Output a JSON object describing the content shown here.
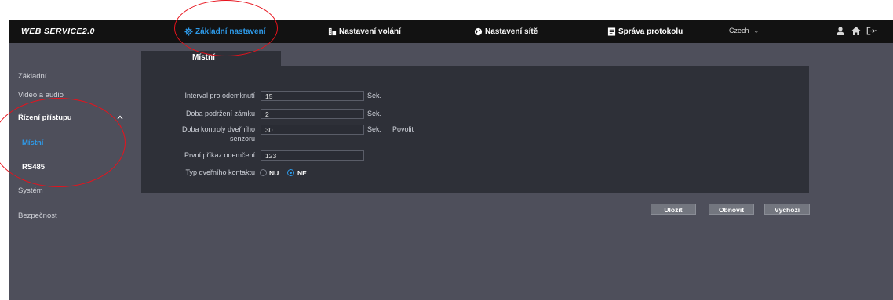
{
  "header": {
    "logo": "WEB SERVICE2.0",
    "nav": [
      {
        "label": "Základní nastavení",
        "icon": "gear-icon",
        "active": true
      },
      {
        "label": "Nastavení volání",
        "icon": "building-icon",
        "active": false
      },
      {
        "label": "Nastavení sítě",
        "icon": "globe-icon",
        "active": false
      },
      {
        "label": "Správa protokolu",
        "icon": "document-icon",
        "active": false
      }
    ],
    "language": "Czech",
    "language_caret": "⌄",
    "icons": [
      "user-icon",
      "home-icon",
      "logout-icon"
    ]
  },
  "sidebar": {
    "items": [
      {
        "label": "Základní"
      },
      {
        "label": "Video a audio"
      },
      {
        "label": "Řízení přístupu"
      },
      {
        "label": "Místní"
      },
      {
        "label": "RS485"
      },
      {
        "label": "Systém"
      },
      {
        "label": "Bezpečnost"
      }
    ]
  },
  "main": {
    "tab": "Místní",
    "fields": [
      {
        "label": "Interval pro odemknutí",
        "value": "15",
        "unit": "Sek."
      },
      {
        "label": "Doba podržení zámku",
        "value": "2",
        "unit": "Sek."
      },
      {
        "label_line1": "Doba kontroly dveřního",
        "label_line2": "senzoru",
        "value": "30",
        "unit": "Sek.",
        "extra": "Povolit"
      },
      {
        "label": "První příkaz odemčení",
        "value": "123"
      }
    ],
    "contact": {
      "label": "Typ dveřního kontaktu",
      "options": [
        {
          "label": "NU",
          "selected": false
        },
        {
          "label": "NE",
          "selected": true
        }
      ]
    },
    "buttons": {
      "save": "Uložit",
      "refresh": "Obnovit",
      "default": "Výchozí"
    }
  },
  "colors": {
    "accent": "#2e9bea",
    "annotation": "#e8121c",
    "panel": "#2e3038",
    "background": "#4e4f5b"
  }
}
